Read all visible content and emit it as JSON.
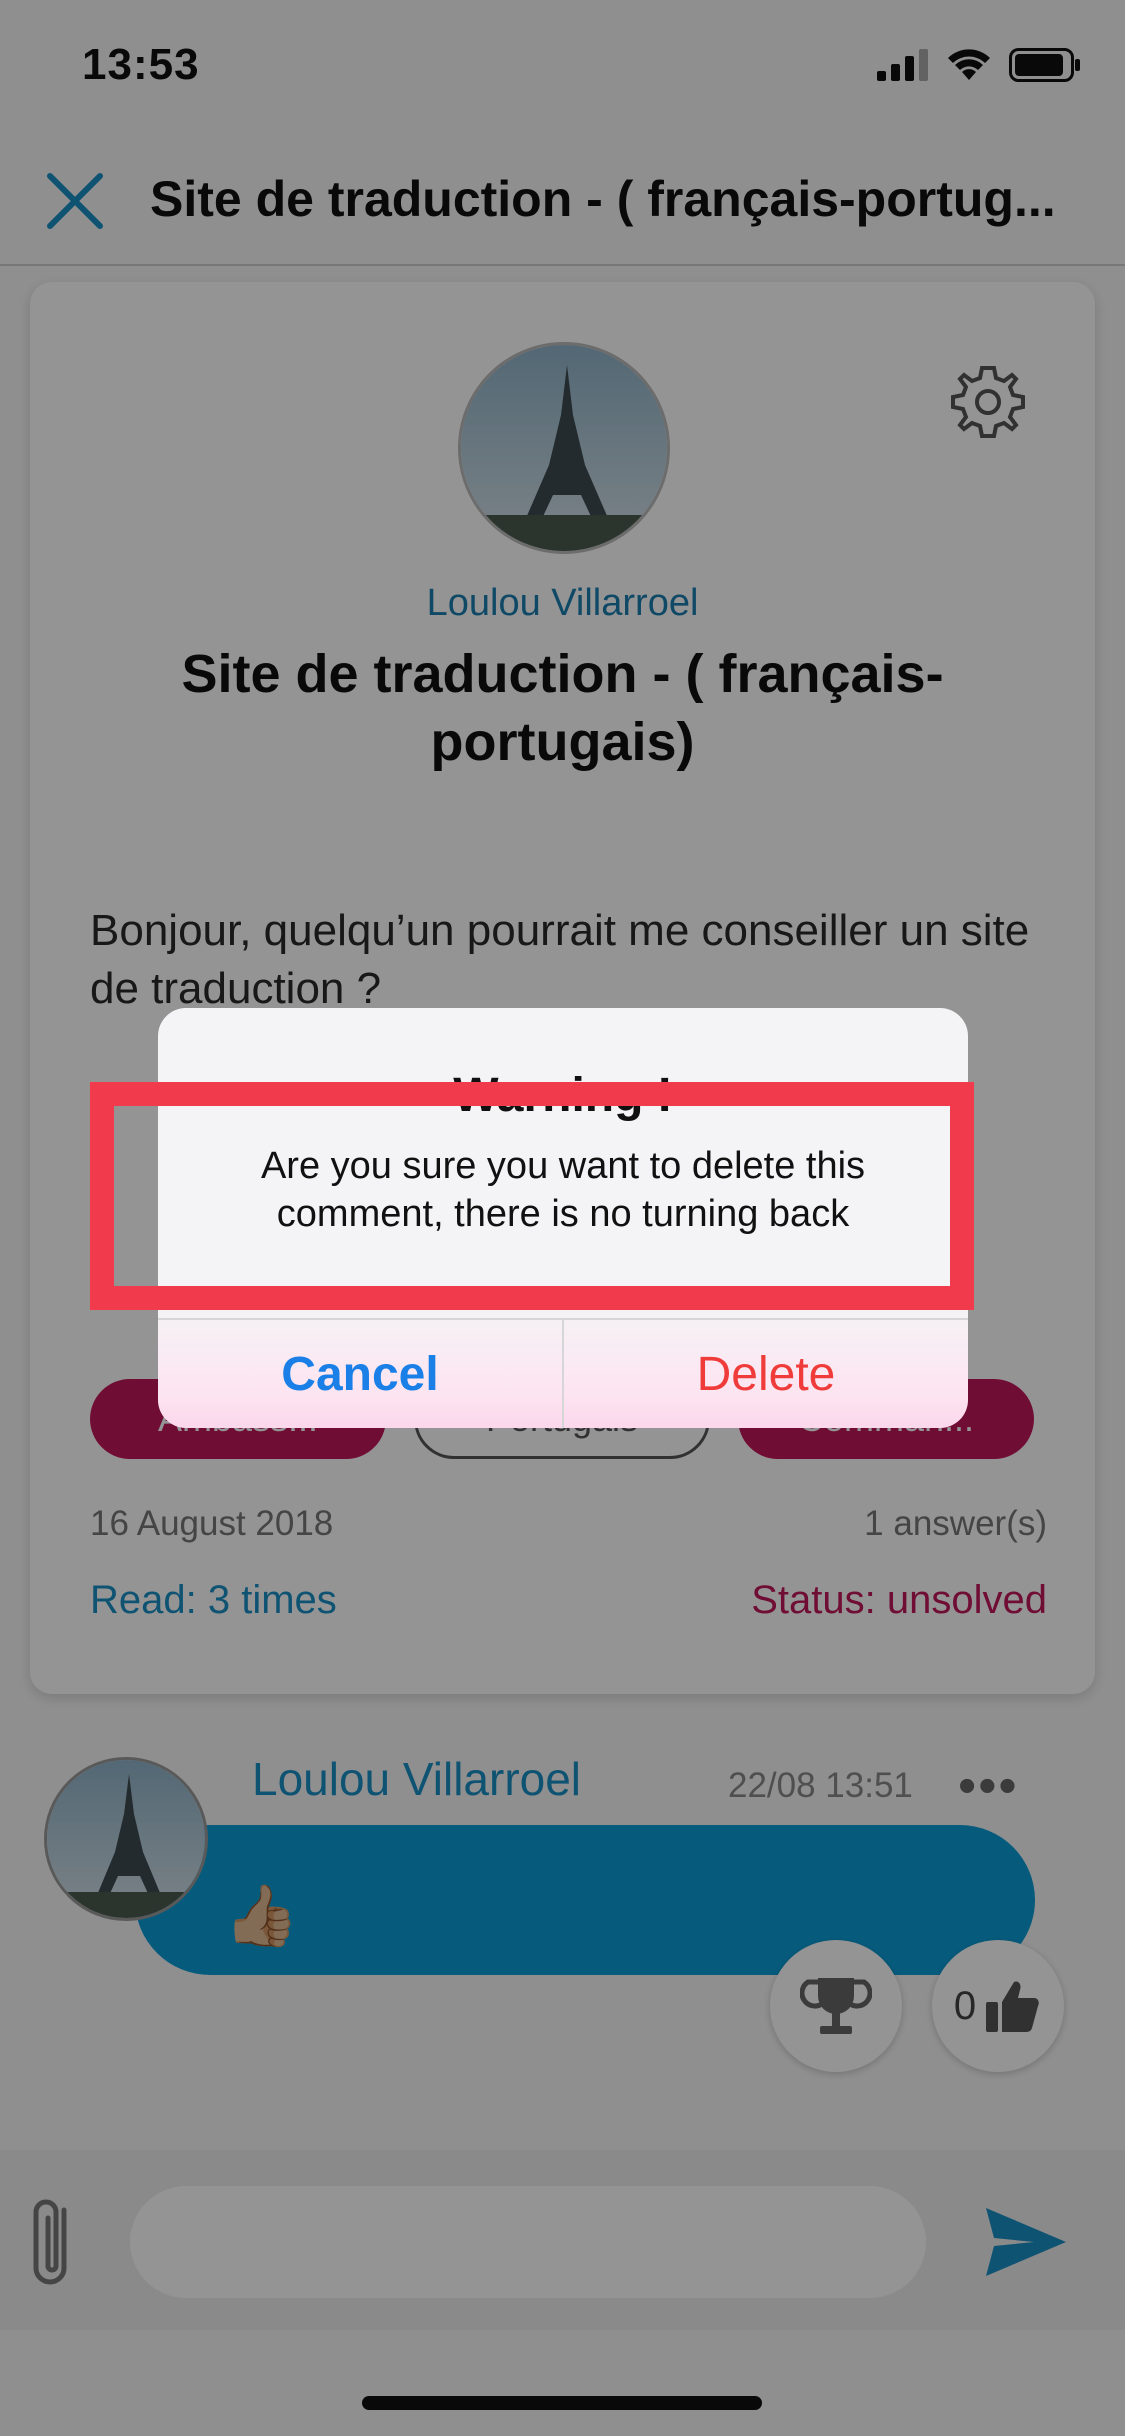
{
  "status_bar": {
    "time": "13:53"
  },
  "nav": {
    "title": "Site de traduction  - ( français-portug..."
  },
  "post": {
    "author": "Loulou Villarroel",
    "title": "Site de traduction  - ( français-portugais)",
    "body": "Bonjour, quelqu’un pourrait me conseiller un site de traduction ?",
    "tags": [
      "Ambass...",
      "Portugais",
      "Comman..."
    ],
    "date": "16 August 2018",
    "answers": "1 answer(s)",
    "read": "Read: 3 times",
    "status": "Status: unsolved"
  },
  "comment": {
    "author": "Loulou Villarroel",
    "time": "22/08 13:51",
    "more": "•••",
    "content": "👍🏼",
    "likes": "0"
  },
  "input": {
    "placeholder": ""
  },
  "alert": {
    "title": "Warning !",
    "message": "Are you sure you want to delete this comment, there is no turning back",
    "cancel_label": "Cancel",
    "delete_label": "Delete"
  },
  "colors": {
    "accent_blue": "#1a8fc6",
    "bubble_blue": "#0c9ed8",
    "tag_pink": "#c2185b",
    "alert_cancel": "#1a7fe6",
    "alert_delete": "#f03b3b",
    "highlight_red": "#f23a4d"
  },
  "icons": {
    "close": "close-icon",
    "settings": "gear-icon",
    "trophy": "trophy-icon",
    "like": "thumbs-up-icon",
    "attach": "paperclip-icon",
    "send": "send-icon"
  }
}
